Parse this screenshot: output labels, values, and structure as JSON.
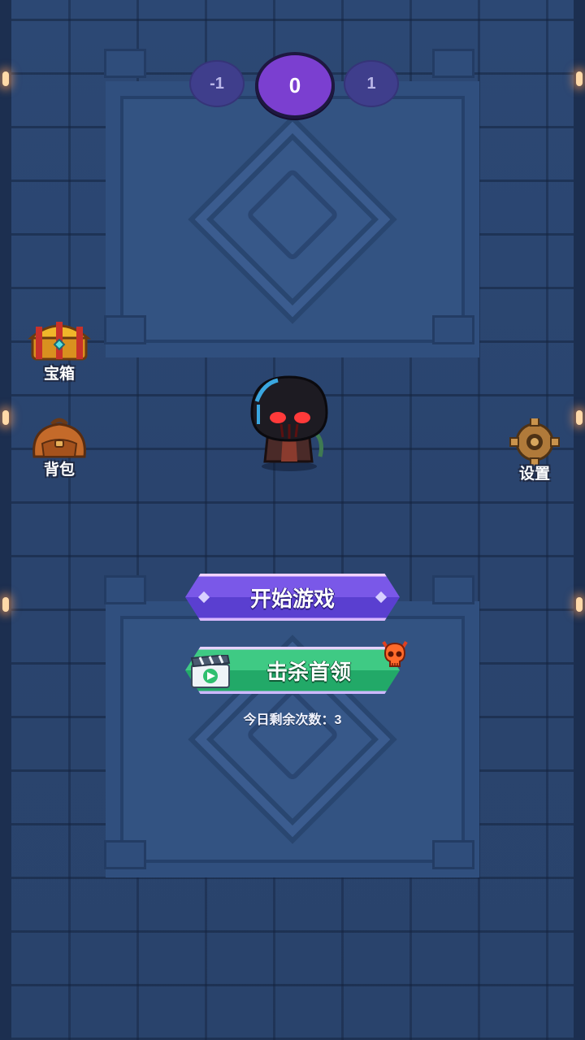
{
  "level_selector": {
    "prev": "-1",
    "current": "0",
    "next": "1"
  },
  "side_buttons": {
    "chest_label": "宝箱",
    "bag_label": "背包",
    "settings_label": "设置"
  },
  "buttons": {
    "start_label": "开始游戏",
    "boss_label": "击杀首领"
  },
  "remaining": "今日剩余次数：3",
  "icons": [
    "treasure-chest-icon",
    "backpack-icon",
    "gear-icon",
    "video-ad-icon",
    "devil-skull-icon",
    "hero-character"
  ],
  "colors": {
    "floor": "#2b4672",
    "start_button": "#6a4be0",
    "boss_button": "#2fb874",
    "level_current": "#7b3fd0"
  }
}
